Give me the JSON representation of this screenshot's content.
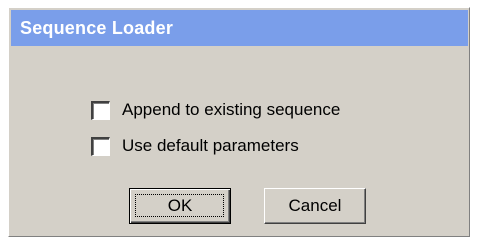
{
  "dialog": {
    "title": "Sequence Loader",
    "options": [
      {
        "label": "Append to existing sequence",
        "checked": false
      },
      {
        "label": "Use default parameters",
        "checked": false
      }
    ],
    "buttons": {
      "ok_label": "OK",
      "cancel_label": "Cancel"
    }
  },
  "colors": {
    "titlebar": "#7a9eea",
    "dialog_face": "#d4d0c8",
    "title_text": "#ffffff"
  }
}
